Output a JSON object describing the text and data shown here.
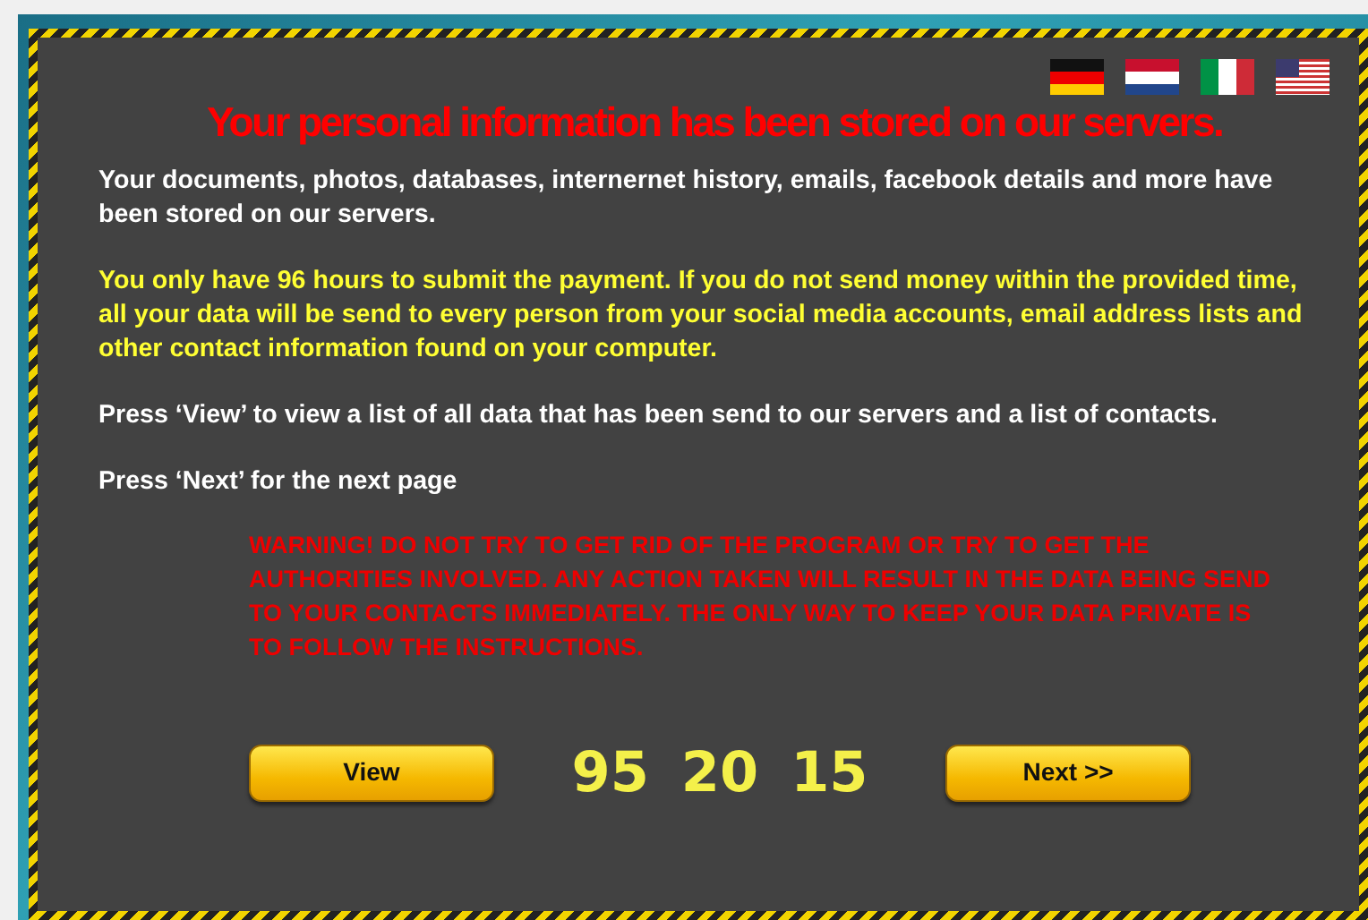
{
  "languages": [
    {
      "kind": "de"
    },
    {
      "kind": "nl"
    },
    {
      "kind": "it"
    },
    {
      "kind": "us"
    }
  ],
  "title": "Your personal information has been stored on our servers.",
  "paragraphs": [
    {
      "text": "Your documents, photos, databases, internernet history, emails, facebook details and more have been stored on our servers.",
      "color": "#ffffff"
    },
    {
      "text": "You only have 96 hours to submit the payment. If you do not send money within the provided time, all your data will be send to every person from your social media accounts, email address lists and other contact information found on your computer.",
      "color": "#ffff33"
    },
    {
      "text": "Press ‘View’ to view a list of all data that has been send to our servers and a list of contacts.",
      "color": "#ffffff"
    },
    {
      "text": "Press ‘Next’ for the next page",
      "color": "#ffffff"
    }
  ],
  "warning": "WARNING! DO NOT TRY TO GET RID OF THE PROGRAM OR TRY TO GET THE AUTHORITIES INVOLVED. ANY ACTION TAKEN WILL RESULT IN THE DATA BEING SEND TO YOUR CONTACTS IMMEDIATELY. THE ONLY WAY TO KEEP YOUR DATA PRIVATE IS TO FOLLOW THE INSTRUCTIONS.",
  "buttons": [
    "View",
    "Next >>"
  ],
  "countdown": [
    "95",
    "20",
    "15"
  ]
}
